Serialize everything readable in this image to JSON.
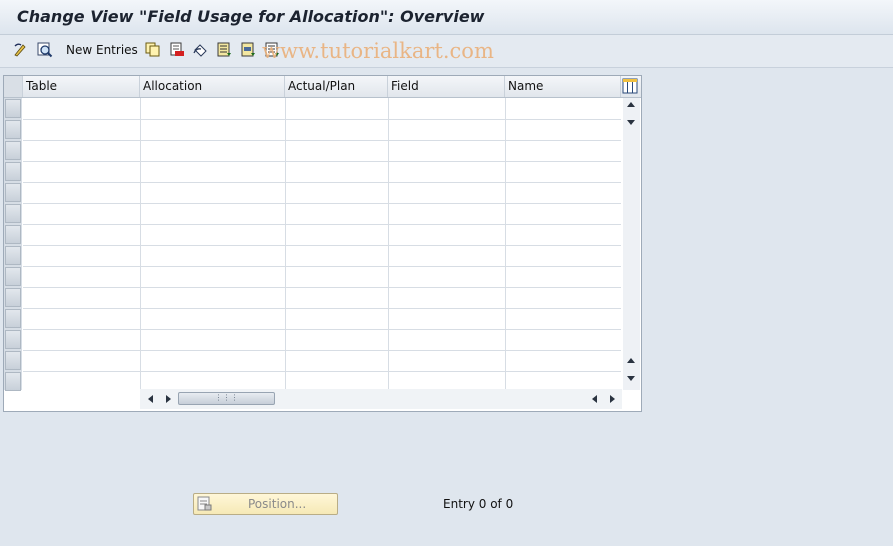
{
  "title": "Change View \"Field Usage for Allocation\": Overview",
  "watermark": "www.tutorialkart.com",
  "toolbar": {
    "new_entries_label": "New Entries",
    "icons": [
      "change-display-icon",
      "details-icon",
      "copy-icon",
      "delete-icon",
      "undo-icon",
      "select-all-icon",
      "select-block-icon",
      "deselect-all-icon"
    ]
  },
  "table": {
    "columns": [
      "Table",
      "Allocation",
      "Actual/Plan",
      "Field",
      "Name"
    ],
    "rows": [],
    "visible_row_count": 14
  },
  "position_button_label": "Position...",
  "entry_status": "Entry 0 of 0",
  "colors": {
    "background": "#dfe6ee",
    "watermark": "#eab07a",
    "position_button": "#f6e9b6"
  }
}
